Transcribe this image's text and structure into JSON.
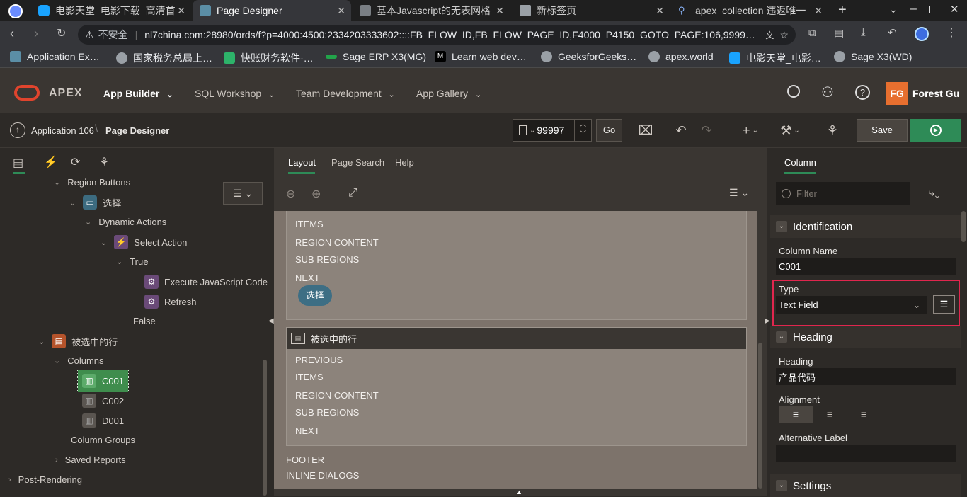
{
  "browser": {
    "tabs": [
      {
        "title": "电影天堂_电影下载_高清首",
        "active": false
      },
      {
        "title": "Page Designer",
        "active": true
      },
      {
        "title": "基本Javascript的无表网格",
        "active": false
      },
      {
        "title": "新标签页",
        "active": false
      },
      {
        "title": "apex_collection 违返唯一",
        "active": false
      }
    ],
    "security_label": "不安全",
    "url": "nl7china.com:28980/ords/f?p=4000:4500:2334203333602::::FB_FLOW_ID,FB_FLOW_PAGE_ID,F4000_P4150_GOTO_PAGE:106,9999…",
    "bookmarks": [
      "Application Ex…",
      "国家税务总局上…",
      "快账财务软件-…",
      "Sage ERP X3(MG)",
      "Learn web dev…",
      "GeeksforGeeks…",
      "apex.world",
      "电影天堂_电影…",
      "Sage X3(WD)"
    ]
  },
  "apex": {
    "logo": "APEX",
    "nav": [
      "App Builder",
      "SQL Workshop",
      "Team Development",
      "App Gallery"
    ],
    "user_initials": "FG",
    "user_name": "Forest Gu",
    "breadcrumb_app": "Application 106",
    "breadcrumb_page": "Page Designer",
    "page_number": "99997",
    "go_label": "Go",
    "save_label": "Save",
    "colors": {
      "accent": "#2e8b57",
      "highlight": "#e0264e",
      "selected_tree": "#3f8d4d"
    }
  },
  "tree": {
    "region_buttons": "Region Buttons",
    "button": "选择",
    "dynamic_actions": "Dynamic Actions",
    "select_action": "Select Action",
    "true_label": "True",
    "exec_js": "Execute JavaScript Code",
    "refresh": "Refresh",
    "false_label": "False",
    "region": "被选中的行",
    "columns": "Columns",
    "c001": "C001",
    "c002": "C002",
    "d001": "D001",
    "column_groups": "Column Groups",
    "saved_reports": "Saved Reports",
    "post_rendering": "Post-Rendering"
  },
  "center": {
    "tabs": [
      "Layout",
      "Page Search",
      "Help"
    ],
    "top_region": [
      "ITEMS",
      "REGION CONTENT",
      "SUB REGIONS",
      "NEXT"
    ],
    "button_label": "选择",
    "region_title": "被选中的行",
    "region_items": [
      "PREVIOUS",
      "ITEMS",
      "REGION CONTENT",
      "SUB REGIONS",
      "NEXT"
    ],
    "footer": "FOOTER",
    "inline_dialogs": "INLINE DIALOGS"
  },
  "props": {
    "tab": "Column",
    "filter_placeholder": "Filter",
    "identification": "Identification",
    "column_name_label": "Column Name",
    "column_name": "C001",
    "type_label": "Type",
    "type_value": "Text Field",
    "heading_group": "Heading",
    "heading_label": "Heading",
    "heading_value": "产品代码",
    "alignment_label": "Alignment",
    "alt_label": "Alternative Label",
    "settings_group": "Settings"
  }
}
